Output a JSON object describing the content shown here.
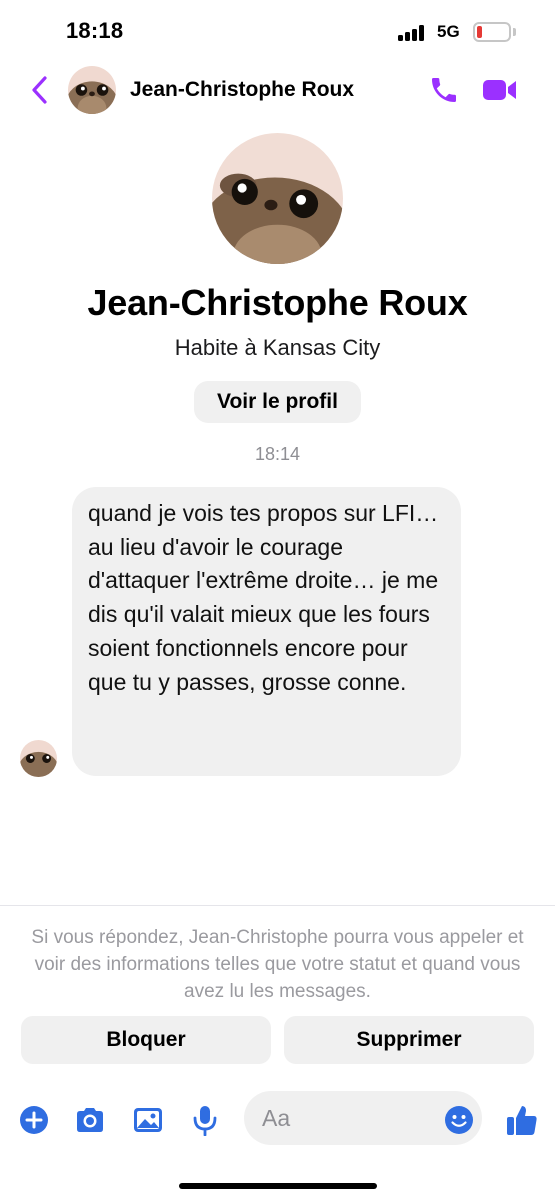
{
  "status_bar": {
    "time": "18:18",
    "network": "5G",
    "battery_level": 0.1
  },
  "header": {
    "name": "Jean-Christophe Roux"
  },
  "profile": {
    "name": "Jean-Christophe Roux",
    "location": "Habite à Kansas City",
    "view_profile_label": "Voir le profil"
  },
  "conversation": {
    "timestamp": "18:14",
    "messages": [
      {
        "text": "quand je vois tes propos sur LFI… au lieu d'avoir le courage d'attaquer l'extrême droite… je me dis qu'il valait mieux que les fours soient fonctionnels encore pour que tu y passes, grosse conne."
      }
    ]
  },
  "notice": {
    "text": "Si vous répondez, Jean-Christophe pourra vous appeler et voir des informations telles que votre statut et quand vous avez lu les messages.",
    "block_label": "Bloquer",
    "delete_label": "Supprimer"
  },
  "composer": {
    "placeholder": "Aa"
  },
  "colors": {
    "accent": "#9b30ff",
    "composer_blue": "#2f6de1",
    "bubble": "#f0f0f0",
    "battery_low": "#e53935"
  },
  "icons": [
    "back-icon",
    "phone-icon",
    "video-icon",
    "plus-icon",
    "camera-icon",
    "gallery-icon",
    "microphone-icon",
    "emoji-icon",
    "thumbs-up-icon"
  ]
}
